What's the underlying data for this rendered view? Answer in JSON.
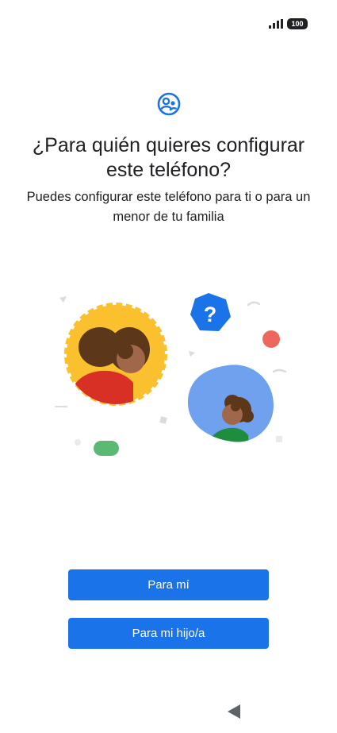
{
  "status_bar": {
    "battery_level": "100",
    "signal_icon": "cellular-signal-icon"
  },
  "header": {
    "icon": "family-profile-icon",
    "title": "¿Para quién quieres configurar este teléfono?",
    "subtitle": "Puedes configurar este teléfono para ti o para un menor de tu familia"
  },
  "illustration": {
    "bubble_text": "?",
    "colors": {
      "blue": "#1a73e8",
      "yellow": "#fbc02d",
      "red": "#d93025",
      "green": "#1e8e3e",
      "light_blue": "#6fa1ef",
      "coral": "#ee675c"
    }
  },
  "actions": {
    "self_label": "Para mí",
    "child_label": "Para mi hijo/a"
  },
  "nav": {
    "back_icon": "back-triangle-icon"
  },
  "theme": {
    "accent": "#1a73e8"
  }
}
